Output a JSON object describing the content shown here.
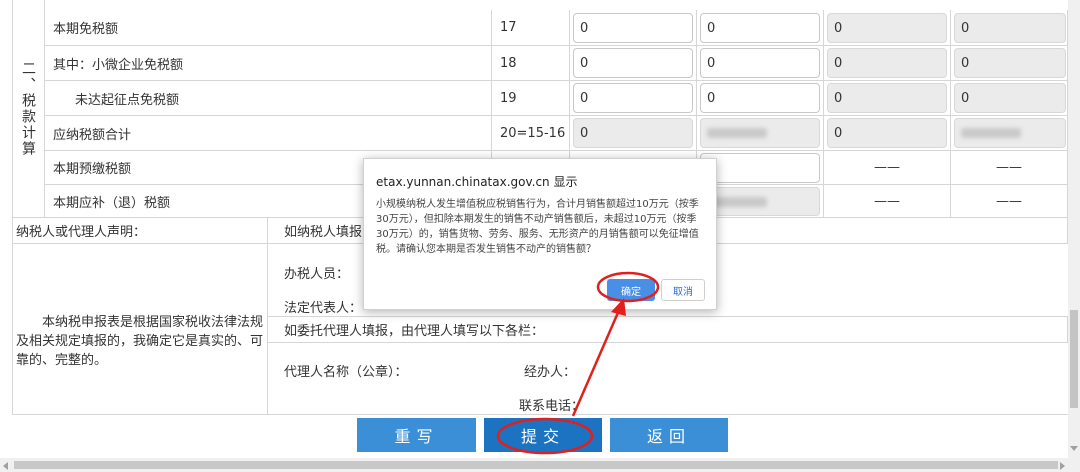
{
  "section": {
    "label": "二、税款计算"
  },
  "rows": [
    {
      "name": "本期免税额",
      "line": "17",
      "v1": "0",
      "v2": "0",
      "v3": "0",
      "v4": "0"
    },
    {
      "name": "其中：小微企业免税额",
      "line": "18",
      "v1": "0",
      "v2": "0",
      "v3": "0",
      "v4": "0"
    },
    {
      "name": "未达起征点免税额",
      "line": "19",
      "v1": "0",
      "v2": "0",
      "v3": "0",
      "v4": "0"
    },
    {
      "name": "应纳税额合计",
      "line": "20=15-16",
      "v1": "0",
      "v3": "0"
    },
    {
      "name": "本期预缴税额",
      "v3": "——",
      "v4": "——"
    },
    {
      "name": "本期应补（退）税额",
      "v3": "——",
      "v4": "——"
    }
  ],
  "declaration": {
    "header": "纳税人或代理人声明：",
    "text": "本纳税申报表是根据国家税收法律法规及相关规定填报的，我确定它是真实的、可靠的、完整的。"
  },
  "taxpayer_fill": {
    "header": "如纳税人填报",
    "handler_label": "办税人员：",
    "legal_rep_label": "法定代表人："
  },
  "agent_fill": {
    "header": "如委托代理人填报，由代理人填写以下各栏：",
    "agent_name_label": "代理人名称（公章）：",
    "handler_label": "经办人：",
    "phone_label": "联系电话："
  },
  "buttons": {
    "rewrite": "重写",
    "submit": "提交",
    "back": "返回"
  },
  "dialog": {
    "title": "etax.yunnan.chinatax.gov.cn 显示",
    "message": "小规模纳税人发生增值税应税销售行为，合计月销售额超过10万元（按季30万元），但扣除本期发生的销售不动产销售额后，未超过10万元（按季30万元）的，销售货物、劳务、服务、无形资产的月销售额可以免征增值税。请确认您本期是否发生销售不动产的销售额？",
    "ok": "确定",
    "cancel": "取消"
  },
  "colors": {
    "button_blue": "#3a8fd6",
    "annotation_red": "#e0201d",
    "dialog_ok": "#4a8fe6"
  }
}
